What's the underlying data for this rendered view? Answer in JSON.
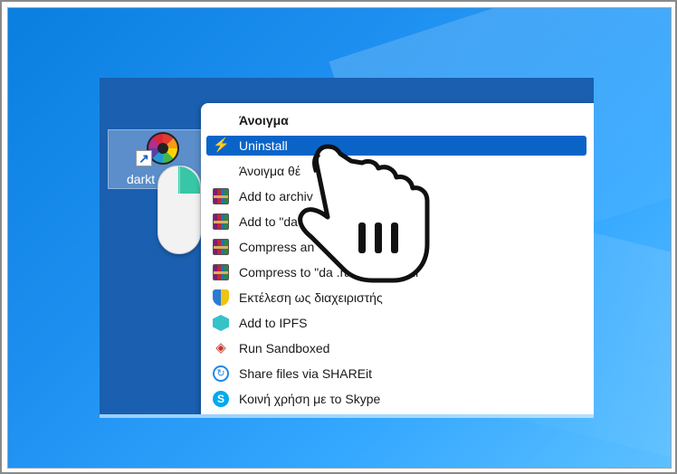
{
  "desktop": {
    "shortcut_label": "darkt"
  },
  "context_menu": {
    "items": [
      {
        "label": "Άνοιγμα",
        "icon": "none",
        "bold": true
      },
      {
        "label": "Uninstall",
        "icon": "lightning-icon",
        "selected": true
      },
      {
        "label": "Άνοιγμα θέ",
        "icon": "none"
      },
      {
        "label": "Add to archiv",
        "icon": "winrar-icon"
      },
      {
        "label": "Add to \"da",
        "icon": "winrar-icon"
      },
      {
        "label": "Compress an",
        "icon": "winrar-icon"
      },
      {
        "label": "Compress to \"da              .rar\" and email",
        "icon": "winrar-icon"
      },
      {
        "label": "Εκτέλεση ως διαχειριστής",
        "icon": "uac-shield-icon"
      },
      {
        "label": "Add to IPFS",
        "icon": "ipfs-cube-icon"
      },
      {
        "label": "Run Sandboxed",
        "icon": "sandboxie-icon"
      },
      {
        "label": "Share files via SHAREit",
        "icon": "shareit-icon"
      },
      {
        "label": "Κοινή χρήση με το Skype",
        "icon": "skype-icon"
      }
    ]
  },
  "colors": {
    "selection": "#0a64c8",
    "wallpaper": "#1d8ff0",
    "mouse_button": "#37c7a6"
  }
}
